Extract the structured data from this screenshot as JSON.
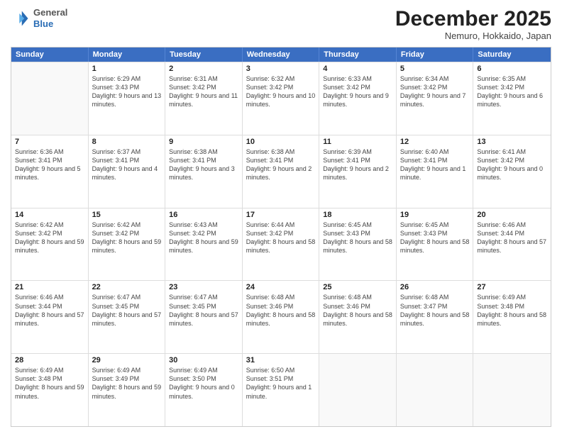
{
  "header": {
    "logo": {
      "general": "General",
      "blue": "Blue"
    },
    "month": "December 2025",
    "location": "Nemuro, Hokkaido, Japan"
  },
  "weekdays": [
    "Sunday",
    "Monday",
    "Tuesday",
    "Wednesday",
    "Thursday",
    "Friday",
    "Saturday"
  ],
  "rows": [
    [
      {
        "day": "",
        "sunrise": "",
        "sunset": "",
        "daylight": "",
        "empty": true
      },
      {
        "day": "1",
        "sunrise": "Sunrise: 6:29 AM",
        "sunset": "Sunset: 3:43 PM",
        "daylight": "Daylight: 9 hours and 13 minutes."
      },
      {
        "day": "2",
        "sunrise": "Sunrise: 6:31 AM",
        "sunset": "Sunset: 3:42 PM",
        "daylight": "Daylight: 9 hours and 11 minutes."
      },
      {
        "day": "3",
        "sunrise": "Sunrise: 6:32 AM",
        "sunset": "Sunset: 3:42 PM",
        "daylight": "Daylight: 9 hours and 10 minutes."
      },
      {
        "day": "4",
        "sunrise": "Sunrise: 6:33 AM",
        "sunset": "Sunset: 3:42 PM",
        "daylight": "Daylight: 9 hours and 9 minutes."
      },
      {
        "day": "5",
        "sunrise": "Sunrise: 6:34 AM",
        "sunset": "Sunset: 3:42 PM",
        "daylight": "Daylight: 9 hours and 7 minutes."
      },
      {
        "day": "6",
        "sunrise": "Sunrise: 6:35 AM",
        "sunset": "Sunset: 3:42 PM",
        "daylight": "Daylight: 9 hours and 6 minutes."
      }
    ],
    [
      {
        "day": "7",
        "sunrise": "Sunrise: 6:36 AM",
        "sunset": "Sunset: 3:41 PM",
        "daylight": "Daylight: 9 hours and 5 minutes."
      },
      {
        "day": "8",
        "sunrise": "Sunrise: 6:37 AM",
        "sunset": "Sunset: 3:41 PM",
        "daylight": "Daylight: 9 hours and 4 minutes."
      },
      {
        "day": "9",
        "sunrise": "Sunrise: 6:38 AM",
        "sunset": "Sunset: 3:41 PM",
        "daylight": "Daylight: 9 hours and 3 minutes."
      },
      {
        "day": "10",
        "sunrise": "Sunrise: 6:38 AM",
        "sunset": "Sunset: 3:41 PM",
        "daylight": "Daylight: 9 hours and 2 minutes."
      },
      {
        "day": "11",
        "sunrise": "Sunrise: 6:39 AM",
        "sunset": "Sunset: 3:41 PM",
        "daylight": "Daylight: 9 hours and 2 minutes."
      },
      {
        "day": "12",
        "sunrise": "Sunrise: 6:40 AM",
        "sunset": "Sunset: 3:41 PM",
        "daylight": "Daylight: 9 hours and 1 minute."
      },
      {
        "day": "13",
        "sunrise": "Sunrise: 6:41 AM",
        "sunset": "Sunset: 3:42 PM",
        "daylight": "Daylight: 9 hours and 0 minutes."
      }
    ],
    [
      {
        "day": "14",
        "sunrise": "Sunrise: 6:42 AM",
        "sunset": "Sunset: 3:42 PM",
        "daylight": "Daylight: 8 hours and 59 minutes."
      },
      {
        "day": "15",
        "sunrise": "Sunrise: 6:42 AM",
        "sunset": "Sunset: 3:42 PM",
        "daylight": "Daylight: 8 hours and 59 minutes."
      },
      {
        "day": "16",
        "sunrise": "Sunrise: 6:43 AM",
        "sunset": "Sunset: 3:42 PM",
        "daylight": "Daylight: 8 hours and 59 minutes."
      },
      {
        "day": "17",
        "sunrise": "Sunrise: 6:44 AM",
        "sunset": "Sunset: 3:42 PM",
        "daylight": "Daylight: 8 hours and 58 minutes."
      },
      {
        "day": "18",
        "sunrise": "Sunrise: 6:45 AM",
        "sunset": "Sunset: 3:43 PM",
        "daylight": "Daylight: 8 hours and 58 minutes."
      },
      {
        "day": "19",
        "sunrise": "Sunrise: 6:45 AM",
        "sunset": "Sunset: 3:43 PM",
        "daylight": "Daylight: 8 hours and 58 minutes."
      },
      {
        "day": "20",
        "sunrise": "Sunrise: 6:46 AM",
        "sunset": "Sunset: 3:44 PM",
        "daylight": "Daylight: 8 hours and 57 minutes."
      }
    ],
    [
      {
        "day": "21",
        "sunrise": "Sunrise: 6:46 AM",
        "sunset": "Sunset: 3:44 PM",
        "daylight": "Daylight: 8 hours and 57 minutes."
      },
      {
        "day": "22",
        "sunrise": "Sunrise: 6:47 AM",
        "sunset": "Sunset: 3:45 PM",
        "daylight": "Daylight: 8 hours and 57 minutes."
      },
      {
        "day": "23",
        "sunrise": "Sunrise: 6:47 AM",
        "sunset": "Sunset: 3:45 PM",
        "daylight": "Daylight: 8 hours and 57 minutes."
      },
      {
        "day": "24",
        "sunrise": "Sunrise: 6:48 AM",
        "sunset": "Sunset: 3:46 PM",
        "daylight": "Daylight: 8 hours and 58 minutes."
      },
      {
        "day": "25",
        "sunrise": "Sunrise: 6:48 AM",
        "sunset": "Sunset: 3:46 PM",
        "daylight": "Daylight: 8 hours and 58 minutes."
      },
      {
        "day": "26",
        "sunrise": "Sunrise: 6:48 AM",
        "sunset": "Sunset: 3:47 PM",
        "daylight": "Daylight: 8 hours and 58 minutes."
      },
      {
        "day": "27",
        "sunrise": "Sunrise: 6:49 AM",
        "sunset": "Sunset: 3:48 PM",
        "daylight": "Daylight: 8 hours and 58 minutes."
      }
    ],
    [
      {
        "day": "28",
        "sunrise": "Sunrise: 6:49 AM",
        "sunset": "Sunset: 3:48 PM",
        "daylight": "Daylight: 8 hours and 59 minutes."
      },
      {
        "day": "29",
        "sunrise": "Sunrise: 6:49 AM",
        "sunset": "Sunset: 3:49 PM",
        "daylight": "Daylight: 8 hours and 59 minutes."
      },
      {
        "day": "30",
        "sunrise": "Sunrise: 6:49 AM",
        "sunset": "Sunset: 3:50 PM",
        "daylight": "Daylight: 9 hours and 0 minutes."
      },
      {
        "day": "31",
        "sunrise": "Sunrise: 6:50 AM",
        "sunset": "Sunset: 3:51 PM",
        "daylight": "Daylight: 9 hours and 1 minute."
      },
      {
        "day": "",
        "sunrise": "",
        "sunset": "",
        "daylight": "",
        "empty": true
      },
      {
        "day": "",
        "sunrise": "",
        "sunset": "",
        "daylight": "",
        "empty": true
      },
      {
        "day": "",
        "sunrise": "",
        "sunset": "",
        "daylight": "",
        "empty": true
      }
    ]
  ]
}
